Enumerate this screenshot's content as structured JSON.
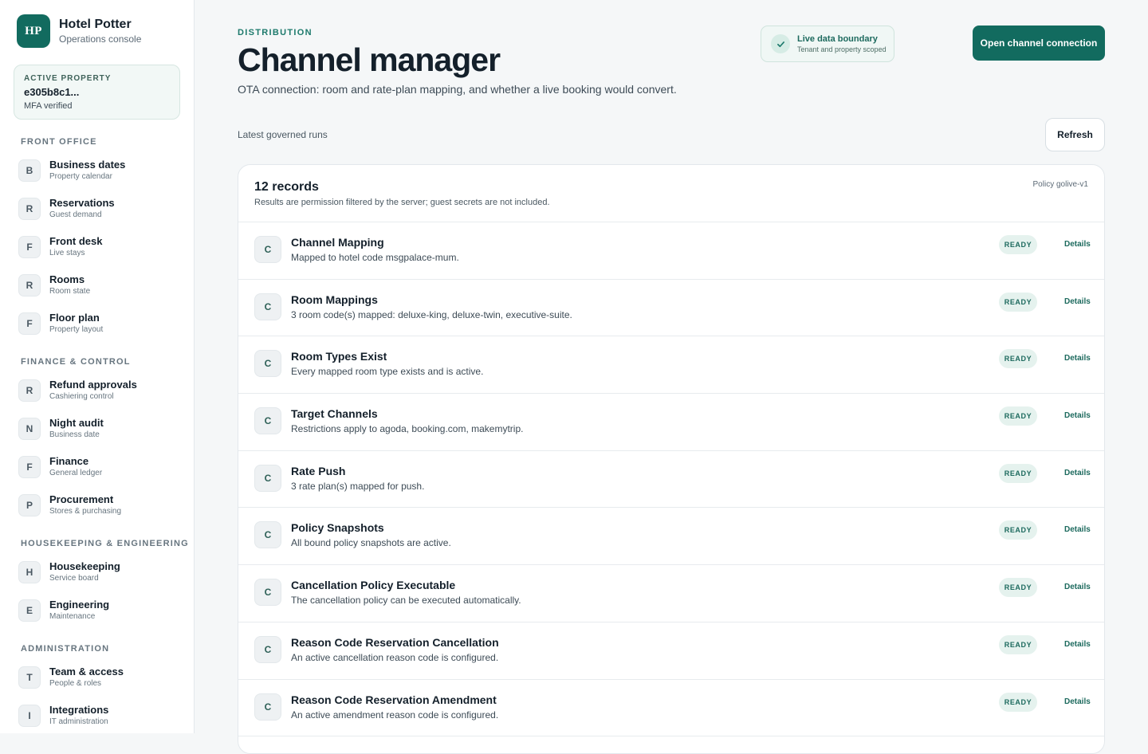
{
  "brand": {
    "logo_text": "HP",
    "name": "Hotel Potter",
    "subtitle": "Operations console"
  },
  "property": {
    "label": "ACTIVE PROPERTY",
    "id": "e305b8c1...",
    "status": "MFA verified"
  },
  "nav": {
    "sections": [
      {
        "title": "FRONT OFFICE",
        "items": [
          {
            "badge": "B",
            "label": "Business dates",
            "sub": "Property calendar"
          },
          {
            "badge": "R",
            "label": "Reservations",
            "sub": "Guest demand"
          },
          {
            "badge": "F",
            "label": "Front desk",
            "sub": "Live stays"
          },
          {
            "badge": "R",
            "label": "Rooms",
            "sub": "Room state"
          },
          {
            "badge": "F",
            "label": "Floor plan",
            "sub": "Property layout"
          }
        ]
      },
      {
        "title": "FINANCE & CONTROL",
        "items": [
          {
            "badge": "R",
            "label": "Refund approvals",
            "sub": "Cashiering control"
          },
          {
            "badge": "N",
            "label": "Night audit",
            "sub": "Business date"
          },
          {
            "badge": "F",
            "label": "Finance",
            "sub": "General ledger"
          },
          {
            "badge": "P",
            "label": "Procurement",
            "sub": "Stores & purchasing"
          }
        ]
      },
      {
        "title": "HOUSEKEEPING & ENGINEERING",
        "items": [
          {
            "badge": "H",
            "label": "Housekeeping",
            "sub": "Service board"
          },
          {
            "badge": "E",
            "label": "Engineering",
            "sub": "Maintenance"
          }
        ]
      },
      {
        "title": "ADMINISTRATION",
        "items": [
          {
            "badge": "T",
            "label": "Team & access",
            "sub": "People & roles"
          },
          {
            "badge": "I",
            "label": "Integrations",
            "sub": "IT administration"
          }
        ]
      }
    ]
  },
  "header": {
    "eyebrow": "DISTRIBUTION",
    "title": "Channel manager",
    "subtitle": "OTA connection: room and rate-plan mapping, and whether a live booking would convert.",
    "boundary_title": "Live data boundary",
    "boundary_sub": "Tenant and property scoped",
    "boundary_icon": "check-icon",
    "primary_button": "Open channel connection"
  },
  "runs": {
    "label": "Latest governed runs",
    "refresh": "Refresh"
  },
  "panel": {
    "count": "12 records",
    "note": "Results are permission filtered by the server; guest secrets are not included.",
    "policy": "Policy golive-v1",
    "rows": [
      {
        "badge": "C",
        "title": "Channel Mapping",
        "desc": "Mapped to hotel code msgpalace-mum.",
        "status": "READY",
        "action": "Details"
      },
      {
        "badge": "C",
        "title": "Room Mappings",
        "desc": "3 room code(s) mapped: deluxe-king, deluxe-twin, executive-suite.",
        "status": "READY",
        "action": "Details"
      },
      {
        "badge": "C",
        "title": "Room Types Exist",
        "desc": "Every mapped room type exists and is active.",
        "status": "READY",
        "action": "Details"
      },
      {
        "badge": "C",
        "title": "Target Channels",
        "desc": "Restrictions apply to agoda, booking.com, makemytrip.",
        "status": "READY",
        "action": "Details"
      },
      {
        "badge": "C",
        "title": "Rate Push",
        "desc": "3 rate plan(s) mapped for push.",
        "status": "READY",
        "action": "Details"
      },
      {
        "badge": "C",
        "title": "Policy Snapshots",
        "desc": "All bound policy snapshots are active.",
        "status": "READY",
        "action": "Details"
      },
      {
        "badge": "C",
        "title": "Cancellation Policy Executable",
        "desc": "The cancellation policy can be executed automatically.",
        "status": "READY",
        "action": "Details"
      },
      {
        "badge": "C",
        "title": "Reason Code Reservation Cancellation",
        "desc": "An active cancellation reason code is configured.",
        "status": "READY",
        "action": "Details"
      },
      {
        "badge": "C",
        "title": "Reason Code Reservation Amendment",
        "desc": "An active amendment reason code is configured.",
        "status": "READY",
        "action": "Details"
      }
    ]
  },
  "colors": {
    "accent": "#126b5f",
    "ready_bg": "#e5f2ee",
    "ready_text": "#1d6a5e"
  }
}
